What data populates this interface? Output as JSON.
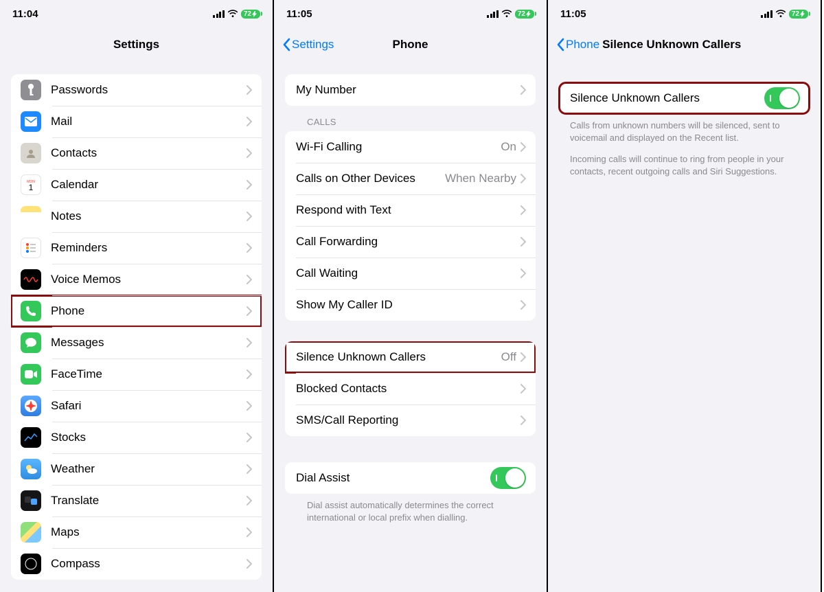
{
  "status": {
    "time1": "11:04",
    "time2": "11:05",
    "time3": "11:05",
    "battery": "72"
  },
  "panel1": {
    "title": "Settings",
    "items": [
      {
        "label": "Passwords"
      },
      {
        "label": "Mail"
      },
      {
        "label": "Contacts"
      },
      {
        "label": "Calendar"
      },
      {
        "label": "Notes"
      },
      {
        "label": "Reminders"
      },
      {
        "label": "Voice Memos"
      },
      {
        "label": "Phone"
      },
      {
        "label": "Messages"
      },
      {
        "label": "FaceTime"
      },
      {
        "label": "Safari"
      },
      {
        "label": "Stocks"
      },
      {
        "label": "Weather"
      },
      {
        "label": "Translate"
      },
      {
        "label": "Maps"
      },
      {
        "label": "Compass"
      }
    ]
  },
  "panel2": {
    "back": "Settings",
    "title": "Phone",
    "g1": {
      "items": [
        {
          "label": "My Number"
        }
      ]
    },
    "g2header": "CALLS",
    "g2": {
      "items": [
        {
          "label": "Wi-Fi Calling",
          "detail": "On"
        },
        {
          "label": "Calls on Other Devices",
          "detail": "When Nearby"
        },
        {
          "label": "Respond with Text"
        },
        {
          "label": "Call Forwarding"
        },
        {
          "label": "Call Waiting"
        },
        {
          "label": "Show My Caller ID"
        }
      ]
    },
    "g3": {
      "items": [
        {
          "label": "Silence Unknown Callers",
          "detail": "Off"
        },
        {
          "label": "Blocked Contacts"
        },
        {
          "label": "SMS/Call Reporting"
        }
      ]
    },
    "g4": {
      "items": [
        {
          "label": "Dial Assist"
        }
      ],
      "footer": "Dial assist automatically determines the correct international or local prefix when dialling."
    }
  },
  "panel3": {
    "back": "Phone",
    "title": "Silence Unknown Callers",
    "row": {
      "label": "Silence Unknown Callers"
    },
    "footer1": "Calls from unknown numbers will be silenced, sent to voicemail and displayed on the Recent list.",
    "footer2": "Incoming calls will continue to ring from people in your contacts, recent outgoing calls and Siri Suggestions."
  }
}
